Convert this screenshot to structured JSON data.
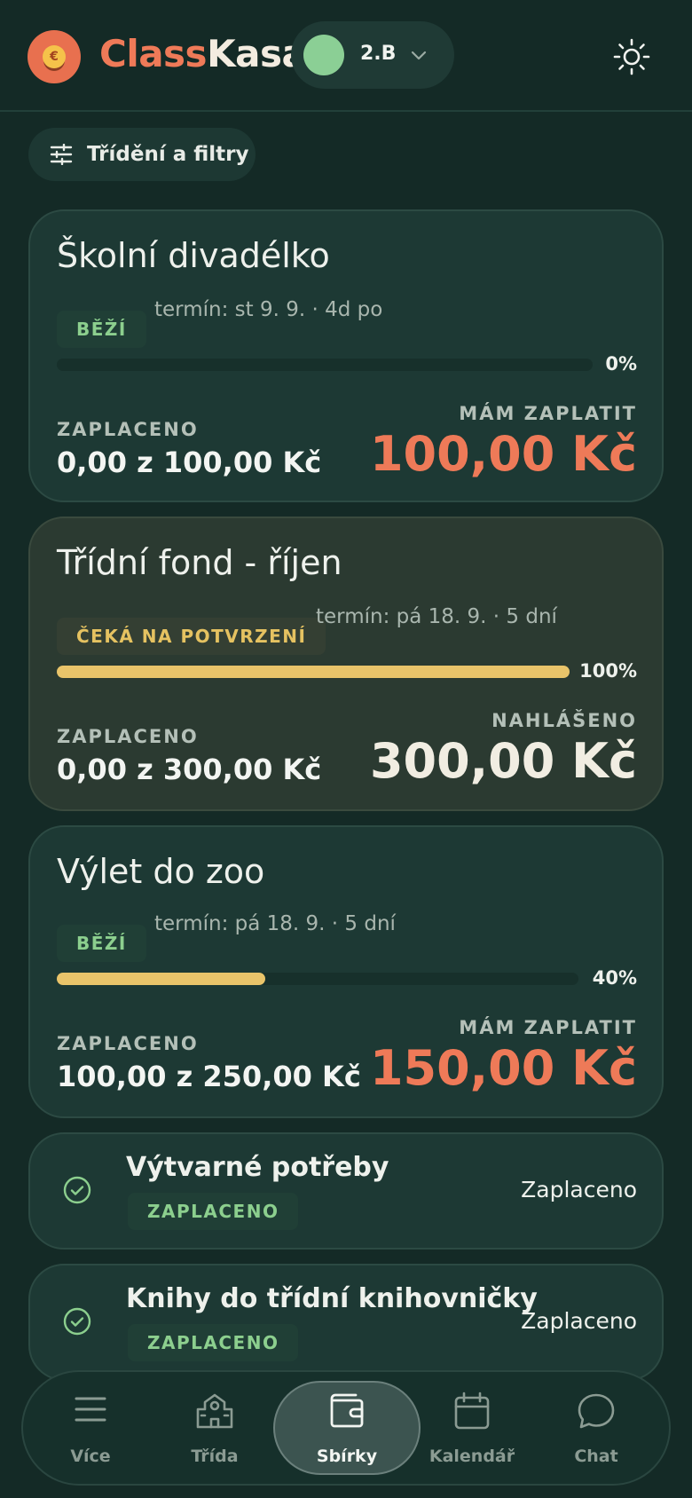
{
  "header": {
    "brand_part1": "Class",
    "brand_part2": "Kasa",
    "coin_symbol": "€",
    "class_name": "2.B"
  },
  "filter_label": "Třídění a filtry",
  "labels": {
    "paid": "ZAPLACENO",
    "to_pay": "MÁM ZAPLATIT",
    "reported": "NAHLÁŠENO"
  },
  "collections": [
    {
      "title": "Školní divadélko",
      "status": "BĚŽÍ",
      "deadline": "termín: st 9. 9. · 4d po",
      "progress": 0,
      "progress_label": "0%",
      "paid": "0,00 z 100,00 Kč",
      "amount_label": "MÁM ZAPLATIT",
      "amount": "100,00 Kč"
    },
    {
      "title": "Třídní fond - říjen",
      "status": "ČEKÁ NA POTVRZENÍ",
      "deadline": "termín: pá 18. 9. · 5 dní",
      "progress": 100,
      "progress_label": "100%",
      "paid": "0,00 z 300,00 Kč",
      "amount_label": "NAHLÁŠENO",
      "amount": "300,00 Kč"
    },
    {
      "title": "Výlet do zoo",
      "status": "BĚŽÍ",
      "deadline": "termín: pá 18. 9. · 5 dní",
      "progress": 40,
      "progress_label": "40%",
      "paid": "100,00 z 250,00 Kč",
      "amount_label": "MÁM ZAPLATIT",
      "amount": "150,00 Kč"
    }
  ],
  "paid_items": [
    {
      "title": "Výtvarné potřeby",
      "badge": "ZAPLACENO",
      "status": "Zaplaceno"
    },
    {
      "title": "Knihy do třídní knihovničky",
      "badge": "ZAPLACENO",
      "status": "Zaplaceno"
    }
  ],
  "nav": [
    {
      "label": "Více",
      "icon": "menu-icon"
    },
    {
      "label": "Třída",
      "icon": "school-icon"
    },
    {
      "label": "Sbírky",
      "icon": "wallet-icon",
      "active": true
    },
    {
      "label": "Kalendář",
      "icon": "calendar-icon"
    },
    {
      "label": "Chat",
      "icon": "chat-icon"
    }
  ],
  "colors": {
    "background": "#142a26",
    "accent_orange": "#ee7a58",
    "progress_yellow": "#e9c46a",
    "status_green": "#8ccf8e"
  }
}
